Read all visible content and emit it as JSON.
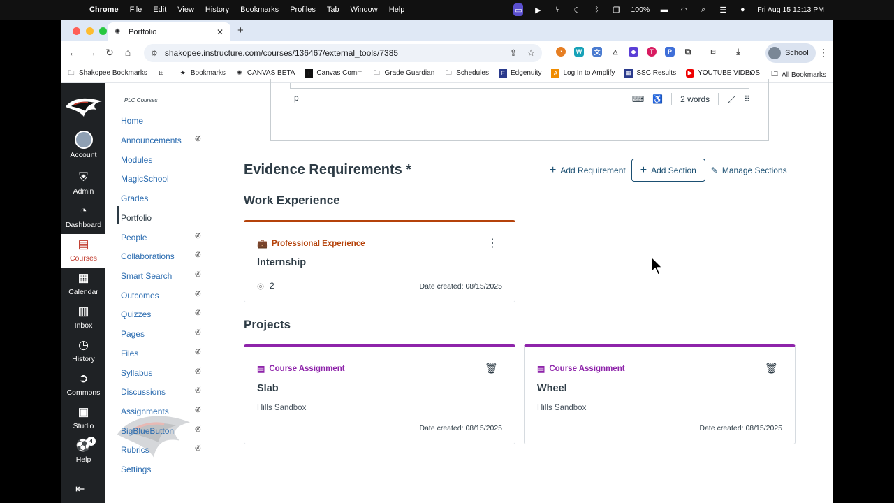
{
  "mac_menu": {
    "app": "Chrome",
    "items": [
      "File",
      "Edit",
      "View",
      "History",
      "Bookmarks",
      "Profiles",
      "Tab",
      "Window",
      "Help"
    ],
    "battery": "100%",
    "clock": "Fri Aug 15  12:13 PM"
  },
  "browser": {
    "tab_title": "Portfolio",
    "url": "shakopee.instructure.com/courses/136467/external_tools/7385",
    "profile": "School",
    "bookmarks": [
      "Shakopee Bookmarks",
      "Bookmarks",
      "CANVAS BETA",
      "Canvas Comm",
      "Grade Guardian",
      "Schedules",
      "Edgenuity",
      "Log In to Amplify",
      "SSC Results",
      "YOUTUBE VIDEOS"
    ],
    "all_bookmarks": "All Bookmarks"
  },
  "global_nav": {
    "account": "Account",
    "admin": "Admin",
    "dashboard": "Dashboard",
    "courses": "Courses",
    "calendar": "Calendar",
    "inbox": "Inbox",
    "history": "History",
    "commons": "Commons",
    "studio": "Studio",
    "help": "Help",
    "help_badge": "4"
  },
  "course_nav": {
    "course_name": "PLC Courses",
    "items": [
      {
        "label": "Home"
      },
      {
        "label": "Announcements"
      },
      {
        "label": "Modules"
      },
      {
        "label": "MagicSchool"
      },
      {
        "label": "Grades"
      },
      {
        "label": "Portfolio"
      },
      {
        "label": "People"
      },
      {
        "label": "Collaborations"
      },
      {
        "label": "Smart Search"
      },
      {
        "label": "Outcomes"
      },
      {
        "label": "Quizzes"
      },
      {
        "label": "Pages"
      },
      {
        "label": "Files"
      },
      {
        "label": "Syllabus"
      },
      {
        "label": "Discussions"
      },
      {
        "label": "Assignments"
      },
      {
        "label": "BigBlueButton"
      },
      {
        "label": "Rubrics"
      },
      {
        "label": "Settings"
      }
    ]
  },
  "editor": {
    "path": "p",
    "word_count": "2 words"
  },
  "evidence": {
    "title": "Evidence Requirements *",
    "add_requirement": "Add Requirement",
    "add_section": "Add Section",
    "manage_sections": "Manage Sections"
  },
  "work_experience": {
    "title": "Work Experience",
    "card": {
      "category": "Professional Experience",
      "title": "Internship",
      "count": "2",
      "date": "Date created: 08/15/2025"
    }
  },
  "projects": {
    "title": "Projects",
    "cards": [
      {
        "category": "Course Assignment",
        "title": "Slab",
        "subtitle": "Hills Sandbox",
        "date": "Date created: 08/15/2025"
      },
      {
        "category": "Course Assignment",
        "title": "Wheel",
        "subtitle": "Hills Sandbox",
        "date": "Date created: 08/15/2025"
      }
    ]
  },
  "colors": {
    "professional": "#b5420a",
    "assignment": "#8e24aa",
    "link": "#2b6cb0",
    "nav_bg": "#1f2225"
  }
}
